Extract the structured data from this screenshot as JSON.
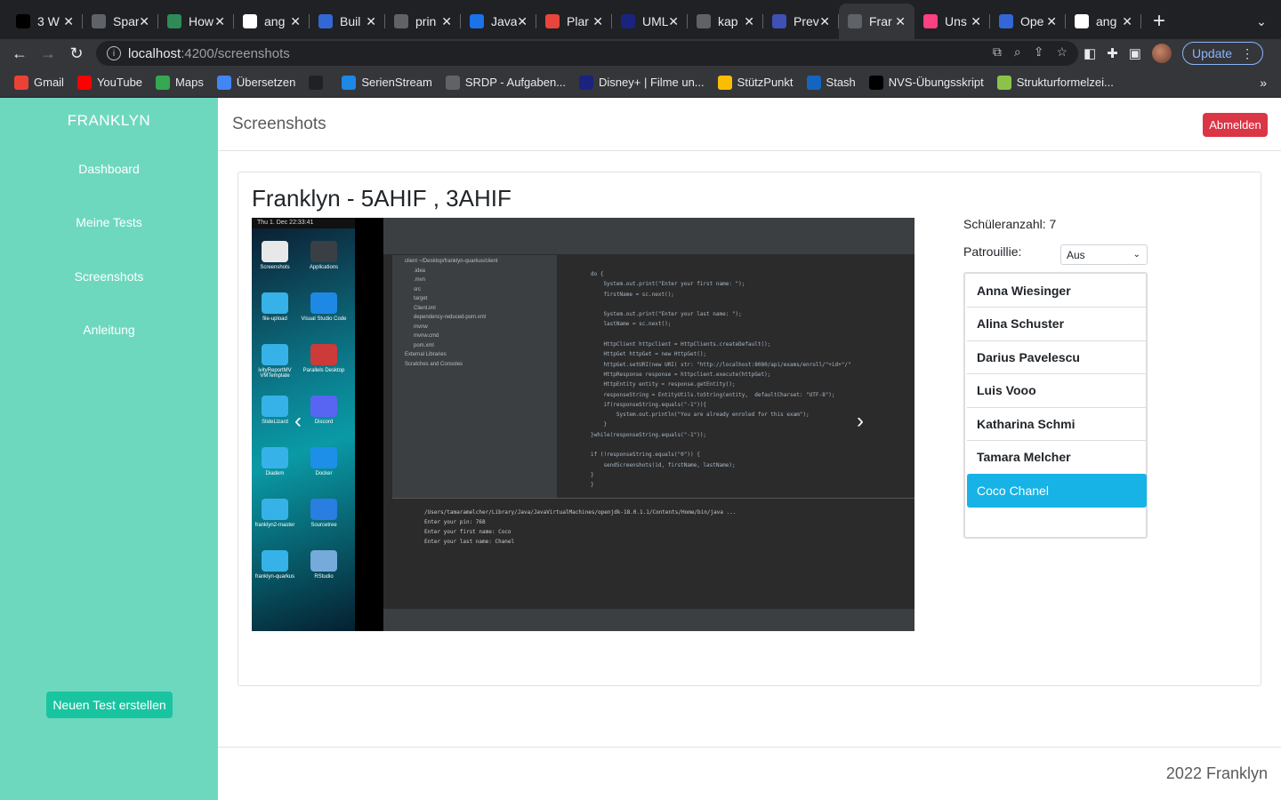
{
  "browser": {
    "tabs": [
      {
        "title": "3 W",
        "icon": "dev-icon",
        "color": "#000000"
      },
      {
        "title": "Spar",
        "icon": "spark-icon",
        "color": "#5f6368"
      },
      {
        "title": "How",
        "icon": "infinity-icon",
        "color": "#2e8b57"
      },
      {
        "title": "ang",
        "icon": "github-icon",
        "color": "#ffffff"
      },
      {
        "title": "Buil",
        "icon": "app-icon",
        "color": "#3367d6"
      },
      {
        "title": "prin",
        "icon": "globe-icon",
        "color": "#5f6368"
      },
      {
        "title": "Java",
        "icon": "a-icon",
        "color": "#1a73e8"
      },
      {
        "title": "Plar",
        "icon": "chart-icon",
        "color": "#e8453c"
      },
      {
        "title": "UML",
        "icon": "i-icon",
        "color": "#1a237e"
      },
      {
        "title": "kap",
        "icon": "globe-icon",
        "color": "#5f6368"
      },
      {
        "title": "Prev",
        "icon": "co-icon",
        "color": "#3f51b5"
      },
      {
        "title": "Frar",
        "icon": "franklyn-icon",
        "color": "#5f6368"
      },
      {
        "title": "Uns",
        "icon": "unsplash-icon",
        "color": "#ff4081"
      },
      {
        "title": "Ope",
        "icon": "app-icon",
        "color": "#3367d6"
      },
      {
        "title": "ang",
        "icon": "google-icon",
        "color": "#ffffff"
      }
    ],
    "active_tab_index": 11,
    "url_host": "localhost",
    "url_rest": ":4200/screenshots",
    "update_label": "Update",
    "bookmarks": [
      {
        "label": "Gmail",
        "color": "#ea4335"
      },
      {
        "label": "YouTube",
        "color": "#ff0000"
      },
      {
        "label": "Maps",
        "color": "#34a853"
      },
      {
        "label": "Übersetzen",
        "color": "#4285f4"
      },
      {
        "label": "",
        "color": "#202124"
      },
      {
        "label": "SerienStream",
        "color": "#1e88e5"
      },
      {
        "label": "SRDP - Aufgaben...",
        "color": "#5f6368"
      },
      {
        "label": "Disney+ | Filme un...",
        "color": "#1a237e"
      },
      {
        "label": "StützPunkt",
        "color": "#fbbc04"
      },
      {
        "label": "Stash",
        "color": "#1565c0"
      },
      {
        "label": "NVS-Übungsskript",
        "color": "#000000"
      },
      {
        "label": "Strukturformelzei...",
        "color": "#8bc34a"
      }
    ]
  },
  "app": {
    "brand": "FRANKLYN",
    "nav": [
      {
        "label": "Dashboard"
      },
      {
        "label": "Meine Tests"
      },
      {
        "label": "Screenshots"
      },
      {
        "label": "Anleitung"
      }
    ],
    "new_test_label": "Neuen Test erstellen",
    "page_title": "Screenshots",
    "logout_label": "Abmelden",
    "card_title": "Franklyn - 5AHIF , 3AHIF",
    "pupil_count_label": "Schüleranzahl: 7",
    "patrol_label": "Patrouillie:",
    "patrol_value": "Aus",
    "students": [
      "Anna Wiesinger",
      "Alina Schuster",
      "Darius Pavelescu",
      "Luis Vooo",
      "Katharina Schmi",
      "Tamara Melcher",
      "Coco Chanel"
    ],
    "selected_student_index": 6,
    "footer": "2022 Franklyn",
    "colors": {
      "sidebar": "#6ed8bf",
      "primary_button": "#19c4a0",
      "danger": "#dc3545",
      "selected": "#17b3e7"
    }
  },
  "screenshot": {
    "clock": "Thu 1. Dec 22:33:41",
    "desktop_icons": [
      "Screenshots",
      "Applications",
      "file-upload",
      "Visual Studio Code",
      "ivityReportMV VMTemplate",
      "Parallels Desktop",
      "SlideLizard",
      "Discord",
      "Diadem",
      "Docker",
      "franklyn2-master",
      "Sourcetree",
      "franklyn-quarkus",
      "RStudio"
    ],
    "tree": [
      "client ~/Desktop/franklyn-quarkus/client",
      ".idea",
      ".mvn",
      "src",
      "target",
      "Client.iml",
      "dependency-reduced-pom.xml",
      "mvnw",
      "mvnw.cmd",
      "pom.xml",
      "External Libraries",
      "Scratches and Consoles"
    ],
    "code": [
      "do {",
      "    System.out.print(\"Enter your first name: \");",
      "    firstName = sc.next();",
      "",
      "    System.out.print(\"Enter your last name: \");",
      "    lastName = sc.next();",
      "",
      "    HttpClient httpclient = HttpClients.createDefault();",
      "    HttpGet httpGet = new HttpGet();",
      "    httpGet.setURI(new URI( str: \"http://localhost:8080/api/exams/enroll/\"+id+\"/\"",
      "    HttpResponse response = httpclient.execute(httpGet);",
      "    HttpEntity entity = response.getEntity();",
      "    responseString = EntityUtils.toString(entity,  defaultCharset: \"UTF-8\");",
      "    if(responseString.equals(\"-1\")){",
      "        System.out.println(\"You are already enroled for this exam\");",
      "    }",
      "}while(responseString.equals(\"-1\"));",
      "",
      "if (!responseString.equals(\"0\")) {",
      "    sendScreenshots(id, firstName, lastName);",
      "}",
      "}"
    ],
    "run": [
      "/Users/tamaramelcher/Library/Java/JavaVirtualMachines/openjdk-18.0.1.1/Contents/Home/bin/java ...",
      "Enter your pin: 768",
      "Enter your first name: Coco",
      "Enter your last name: Chanel"
    ]
  }
}
